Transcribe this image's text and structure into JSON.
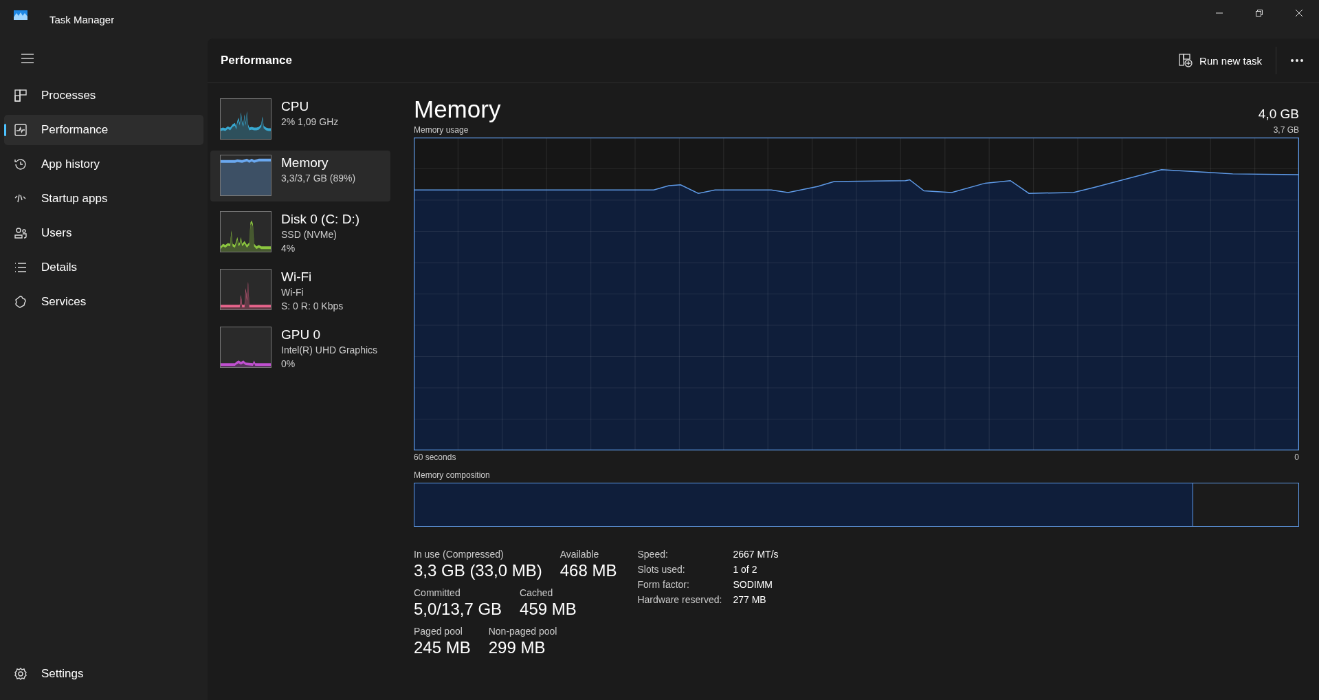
{
  "window": {
    "title": "Task Manager"
  },
  "nav": {
    "items": [
      {
        "label": "Processes",
        "selected": false
      },
      {
        "label": "Performance",
        "selected": true
      },
      {
        "label": "App history",
        "selected": false
      },
      {
        "label": "Startup apps",
        "selected": false
      },
      {
        "label": "Users",
        "selected": false
      },
      {
        "label": "Details",
        "selected": false
      },
      {
        "label": "Services",
        "selected": false
      }
    ],
    "settings": "Settings"
  },
  "header": {
    "title": "Performance",
    "run_new_task": "Run new task"
  },
  "devices": [
    {
      "name": "CPU",
      "lines": [
        "2%  1,09 GHz"
      ],
      "selected": false,
      "color": "#38a8d0"
    },
    {
      "name": "Memory",
      "lines": [
        "3,3/3,7 GB (89%)"
      ],
      "selected": true,
      "color": "#6aa8f0"
    },
    {
      "name": "Disk 0 (C: D:)",
      "lines": [
        "SSD (NVMe)",
        "4%"
      ],
      "selected": false,
      "color": "#8cc63f"
    },
    {
      "name": "Wi-Fi",
      "lines": [
        "Wi-Fi",
        "S: 0 R: 0 Kbps"
      ],
      "selected": false,
      "color": "#e8648c"
    },
    {
      "name": "GPU 0",
      "lines": [
        "Intel(R) UHD Graphics",
        "0%"
      ],
      "selected": false,
      "color": "#c050d0"
    }
  ],
  "memory": {
    "title": "Memory",
    "total": "4,0 GB",
    "usage_label": "Memory usage",
    "usage_max": "3,7 GB",
    "x_start": "60 seconds",
    "x_end": "0",
    "composition_label": "Memory composition",
    "composition": {
      "level": 0.88
    },
    "stats": [
      [
        {
          "label": "In use (Compressed)",
          "value": "3,3 GB (33,0 MB)"
        },
        {
          "label": "Available",
          "value": "468 MB"
        }
      ],
      [
        {
          "label": "Committed",
          "value": "5,0/13,7 GB"
        },
        {
          "label": "Cached",
          "value": "459 MB"
        }
      ],
      [
        {
          "label": "Paged pool",
          "value": "245 MB"
        },
        {
          "label": "Non-paged pool",
          "value": "299 MB"
        }
      ]
    ],
    "details": [
      {
        "label": "Speed:",
        "value": "2667 MT/s"
      },
      {
        "label": "Slots used:",
        "value": "1 of 2"
      },
      {
        "label": "Form factor:",
        "value": "SODIMM"
      },
      {
        "label": "Hardware reserved:",
        "value": "277 MB"
      }
    ]
  }
}
